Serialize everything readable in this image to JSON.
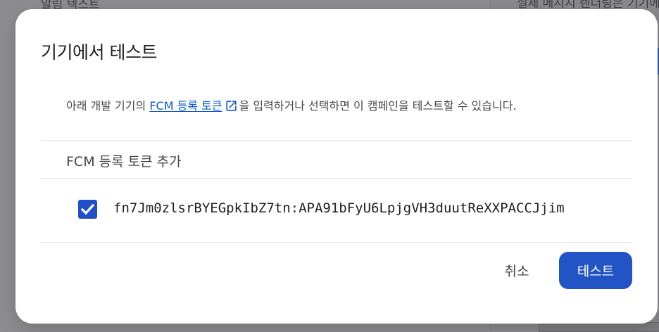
{
  "background": {
    "left_text": "알림 텍스트",
    "right_text": "실제 메시지 렌더링은 기기에"
  },
  "dialog": {
    "title": "기기에서 테스트",
    "description": {
      "prefix": "아래 개발 기기의 ",
      "link_text": "FCM 등록 토큰",
      "suffix": "을 입력하거나 선택하면 이 캠페인을 테스트할 수 있습니다."
    },
    "add_token_label": "FCM 등록 토큰 추가",
    "tokens": [
      {
        "value": "fn7Jm0zlsrBYEGpkIbZ7tn:APA91bFyU6LpjgVH3duutReXXPACCJjim",
        "checked": true
      }
    ],
    "buttons": {
      "cancel": "취소",
      "test": "테스트"
    }
  },
  "colors": {
    "primary": "#2254c6",
    "link": "#0b57d0",
    "scrim": "#8e8e90"
  }
}
